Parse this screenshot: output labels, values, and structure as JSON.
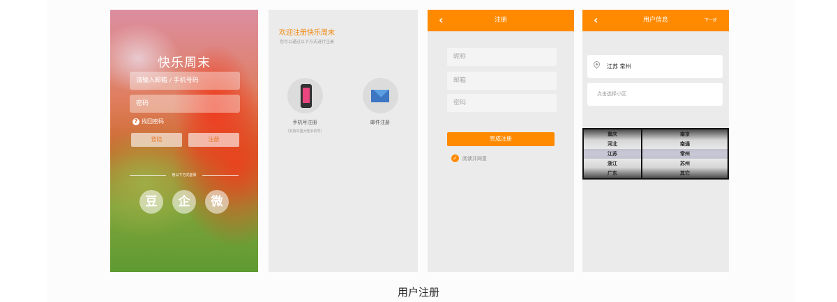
{
  "caption": "用户注册",
  "login": {
    "logo": "快乐周末",
    "account_placeholder": "请输入邮箱 / 手机号码",
    "password_placeholder": "密码",
    "forgot": "找回密码",
    "login_button": "登陆",
    "register_button": "注册",
    "divider": "用以下方式登录",
    "social": [
      "豆",
      "企",
      "微"
    ]
  },
  "choose": {
    "welcome": "欢迎注册快乐周末",
    "subtitle": "您可以通过以下方式进行注册",
    "phone_label": "手机号注册",
    "phone_sub": "（支持中国大陆手机号）",
    "mail_label": "邮件注册"
  },
  "register": {
    "title": "注册",
    "fields": [
      "昵称",
      "邮箱",
      "密码"
    ],
    "submit": "完成注册",
    "agree": "阅读并同意"
  },
  "userinfo": {
    "title": "用户信息",
    "next": "下一步",
    "location": "江苏 常州",
    "community_placeholder": "点击选择小区",
    "provinces": [
      "重庆",
      "河北",
      "江苏",
      "浙江",
      "广东"
    ],
    "cities": [
      "南京",
      "南通",
      "常州",
      "苏州",
      "其它"
    ],
    "selected_index": 2
  },
  "colors": {
    "accent": "#ff8a00",
    "gray_bg": "#ebebeb"
  }
}
